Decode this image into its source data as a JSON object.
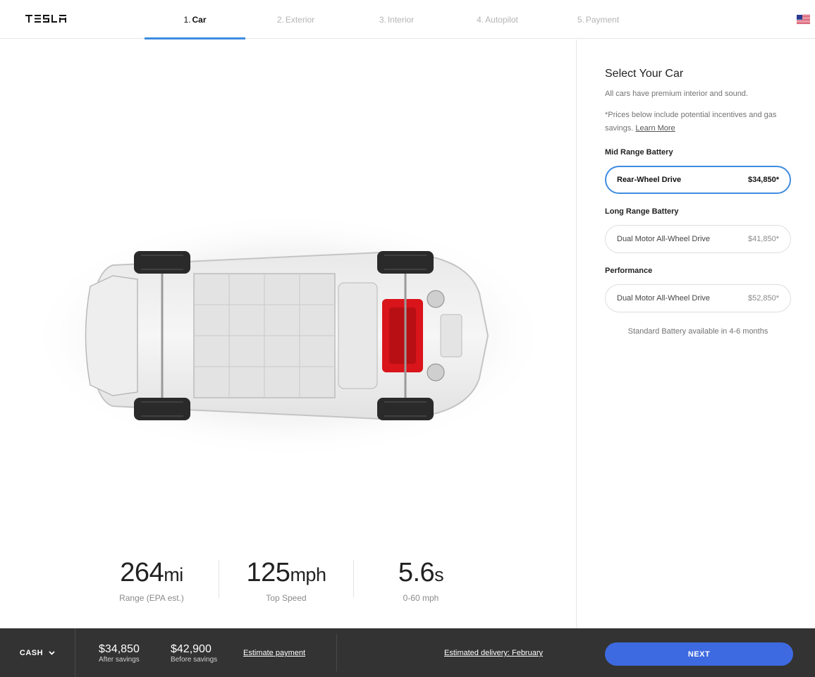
{
  "brand": {
    "logo_text": "TESLA"
  },
  "steps": [
    {
      "num": "1.",
      "label": "Car",
      "active": true
    },
    {
      "num": "2.",
      "label": "Exterior"
    },
    {
      "num": "3.",
      "label": "Interior"
    },
    {
      "num": "4.",
      "label": "Autopilot"
    },
    {
      "num": "5.",
      "label": "Payment"
    }
  ],
  "header": {
    "flag_icon": "us-flag-icon"
  },
  "stats": [
    {
      "value": "264",
      "unit": "mi",
      "label": "Range (EPA est.)"
    },
    {
      "value": "125",
      "unit": "mph",
      "label": "Top Speed"
    },
    {
      "value": "5.6",
      "unit": "s",
      "label": "0-60 mph"
    }
  ],
  "panel": {
    "title": "Select Your Car",
    "subtitle": "All cars have premium interior and sound.",
    "note": "*Prices below include potential incentives and gas savings.",
    "learn_more": "Learn More",
    "groups": [
      {
        "label": "Mid Range Battery",
        "option": {
          "name": "Rear-Wheel Drive",
          "price": "$34,850*",
          "selected": true
        }
      },
      {
        "label": "Long Range Battery",
        "option": {
          "name": "Dual Motor All-Wheel Drive",
          "price": "$41,850*"
        }
      },
      {
        "label": "Performance",
        "option": {
          "name": "Dual Motor All-Wheel Drive",
          "price": "$52,850*"
        }
      }
    ],
    "availability": "Standard Battery available in 4-6 months"
  },
  "footer": {
    "payment_method": "CASH",
    "after_savings_amount": "$34,850",
    "after_savings_label": "After savings",
    "before_savings_amount": "$42,900",
    "before_savings_label": "Before savings",
    "estimate_payment": "Estimate payment",
    "delivery": "Estimated delivery: February",
    "next": "NEXT"
  },
  "colors": {
    "accent": "#3e8ce0",
    "button": "#3e6ae1",
    "footer_bg": "#333333",
    "motor": "#d9141a"
  }
}
